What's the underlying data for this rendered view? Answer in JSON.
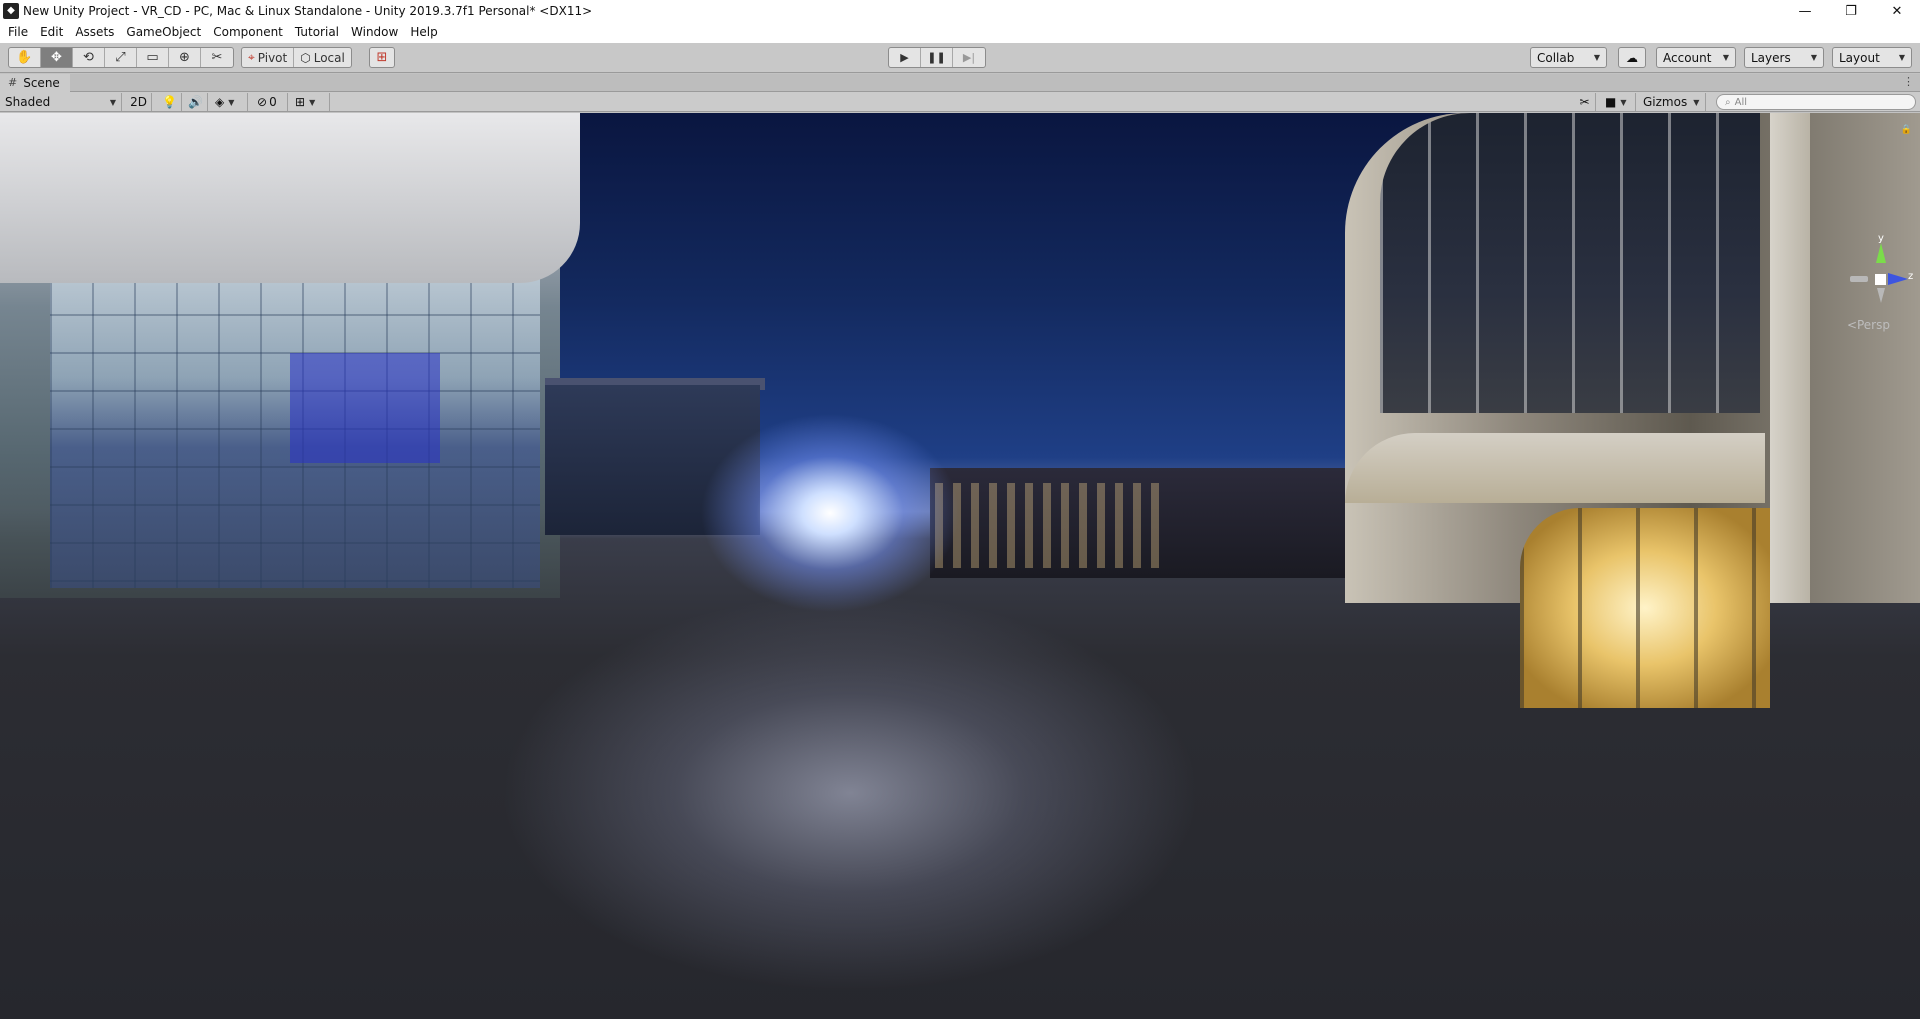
{
  "window": {
    "title": "New Unity Project - VR_CD - PC, Mac & Linux Standalone - Unity 2019.3.7f1 Personal* <DX11>",
    "controls": [
      "—",
      "❐",
      "✕"
    ]
  },
  "menu": [
    "File",
    "Edit",
    "Assets",
    "GameObject",
    "Component",
    "Tutorial",
    "Window",
    "Help"
  ],
  "toolbar": {
    "pivot_label": "Pivot",
    "local_label": "Local",
    "collab_label": "Collab",
    "account_label": "Account",
    "layers_label": "Layers",
    "layout_label": "Layout"
  },
  "scene_tab": {
    "label": "Scene"
  },
  "scene_toolbar": {
    "shading_mode": "Shaded",
    "mode_2d": "2D",
    "hidden_count": "0",
    "gizmos_label": "Gizmos",
    "search_placeholder": "All"
  },
  "gizmo": {
    "y_label": "y",
    "z_label": "z",
    "projection": "<Persp"
  },
  "colors": {
    "axis_y": "#7bdc4a",
    "axis_z": "#3d55e0",
    "toolbar_bg": "#c8c8c8"
  }
}
